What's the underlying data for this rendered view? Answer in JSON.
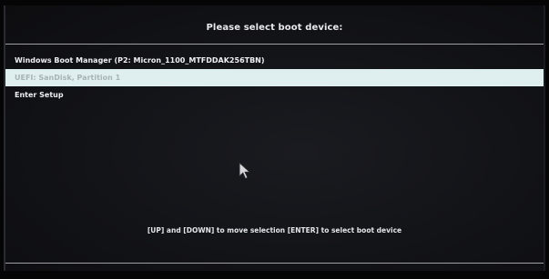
{
  "screen": {
    "title": "Please select boot device:",
    "items": [
      {
        "label": "Windows Boot Manager (P2: Micron_1100_MTFDDAK256TBN)",
        "selected": false
      },
      {
        "label": "UEFI: SanDisk, Partition 1",
        "selected": true
      },
      {
        "label": "Enter Setup",
        "selected": false
      }
    ],
    "hint": "[UP] and [DOWN] to move selection  [ENTER] to select boot device"
  },
  "icons": {
    "pointer": "mouse-pointer-icon"
  },
  "colors": {
    "background": "#121317",
    "text": "#f0f0f2",
    "selection": "#dfeeee"
  }
}
